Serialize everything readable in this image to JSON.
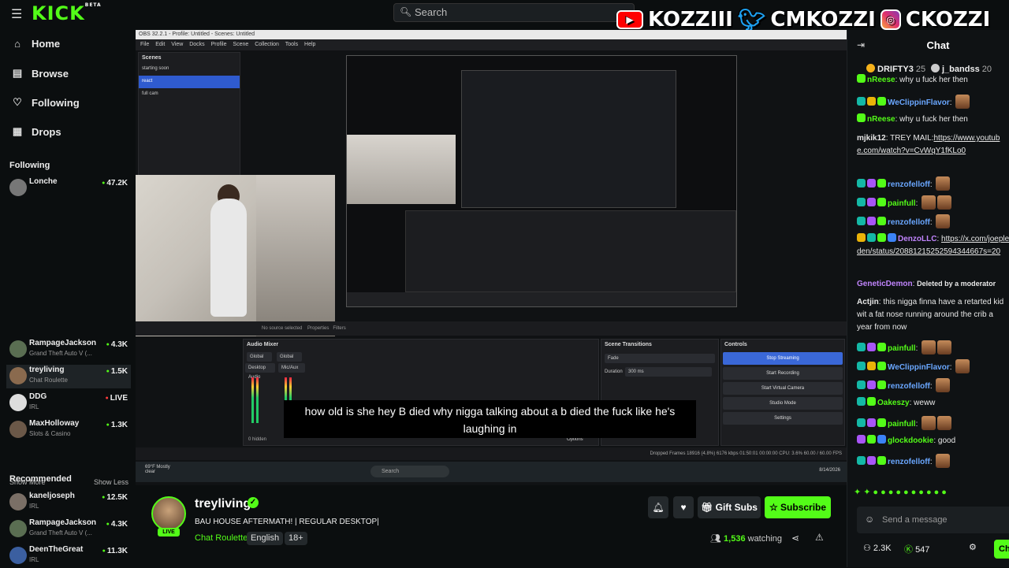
{
  "topbar": {
    "logo": "KICK",
    "logo_beta": "BETA",
    "search_placeholder": "Search"
  },
  "overlay": {
    "youtube": "KOZZIII",
    "twitter": "CMKOZZI",
    "instagram": "CKOZZI"
  },
  "nav": [
    {
      "label": "Home",
      "icon": "home-icon"
    },
    {
      "label": "Browse",
      "icon": "browse-icon"
    },
    {
      "label": "Following",
      "icon": "heart-icon"
    },
    {
      "label": "Drops",
      "icon": "drops-icon"
    }
  ],
  "following": {
    "title": "Following",
    "channels": [
      {
        "name": "Lonche",
        "category": "",
        "viewers": "47.2K"
      },
      {
        "name": "RampageJackson",
        "category": "Grand Theft Auto V (...",
        "viewers": "4.3K"
      },
      {
        "name": "treyliving",
        "category": "Chat Roulette",
        "viewers": "1.5K"
      },
      {
        "name": "DDG",
        "category": "IRL",
        "viewers": "LIVE"
      },
      {
        "name": "MaxHolloway",
        "category": "Slots & Casino",
        "viewers": "1.3K"
      }
    ],
    "show_more": "Show More",
    "show_less": "Show Less"
  },
  "recommended": {
    "title": "Recommended",
    "channels": [
      {
        "name": "kaneljoseph",
        "category": "IRL",
        "viewers": "12.5K"
      },
      {
        "name": "RampageJackson",
        "category": "Grand Theft Auto V (...",
        "viewers": "4.3K"
      },
      {
        "name": "DeenTheGreat",
        "category": "IRL",
        "viewers": "11.3K"
      }
    ]
  },
  "stream": {
    "obs_title": "OBS 32.2.1 - Profile: Untitled - Scenes: Untitled",
    "obs_menu": "File Edit View Docks Profile Scene Collection Tools Help",
    "scenes_title": "Scenes",
    "scenes": [
      "starting soon",
      "react",
      "full cam"
    ],
    "no_source": "No source selected",
    "properties": "Properties",
    "filters": "Filters",
    "audio_mixer": "Audio Mixer",
    "mixer_tabs": [
      "Global",
      "Global"
    ],
    "mixer_channels": [
      "Desktop Audio",
      "Mic/Aux"
    ],
    "hidden": "0 hidden",
    "scene_transitions": "Scene Transitions",
    "transition": "Fade",
    "duration_label": "Duration",
    "duration": "300 ms",
    "controls_title": "Controls",
    "controls": [
      "Stop Streaming",
      "Start Recording",
      "Start Virtual Camera",
      "Studio Mode",
      "Settings"
    ],
    "options": "Options",
    "status": "Dropped Frames 18916 (4.8%)   6176 kbps   01:50:01   00:00:00   CPU: 3.6%   60.00 / 60.00 FPS",
    "weather": "69°F Mostly clear",
    "task_search": "Search",
    "clock": "8/14/2026",
    "subtitle": "how old is she hey B died why nigga talking about a b died the fuck like he's laughing in"
  },
  "channel": {
    "name": "treyliving",
    "live": "LIVE",
    "title": "BAU HOUSE AFTERMATH! | REGULAR DESKTOP|",
    "category": "Chat Roulette",
    "tags": [
      "English",
      "18+"
    ],
    "gift_subs": "Gift Subs",
    "subscribe": "Subscribe",
    "watching_count": "1,536",
    "watching_label": "watching"
  },
  "chat": {
    "title": "Chat",
    "top_gifters": [
      {
        "name": "DRIFTY3",
        "count": "25"
      },
      {
        "name": "j_bandss",
        "count": "20"
      }
    ],
    "messages": [
      {
        "user": "nReese",
        "text": "why u fuck her then",
        "color": "#53fc18"
      },
      {
        "user": "WeClippinFlavor",
        "text": "",
        "color": "#3b82f6"
      },
      {
        "user": "nReese",
        "text": "why u fuck her then",
        "color": "#53fc18"
      },
      {
        "user": "mjkik12",
        "text": "TREY MAIL:",
        "link": "https://www.youtube.com/watch?v=CvWqY1fKLo0",
        "color": "#e8e8e8"
      },
      {
        "user": "renzofelloff",
        "text": "",
        "color": "#3b82f6"
      },
      {
        "user": "painfull",
        "text": "",
        "color": "#53fc18"
      },
      {
        "user": "renzofelloff",
        "text": "",
        "color": "#3b82f6"
      },
      {
        "user": "DenzoLLC",
        "text": "",
        "link": "https://x.com/joepleden/status/20881215252594344667s=20",
        "color": "#a855f7"
      },
      {
        "user": "GeneticDemon",
        "text": "Deleted by a moderator",
        "color": "#a855f7"
      },
      {
        "user": "Actjin",
        "text": "this nigga finna have a retarted kid wit a fat nose running around the crib a year from now",
        "color": "#e8e8e8"
      },
      {
        "user": "painfull",
        "text": "",
        "color": "#53fc18"
      },
      {
        "user": "WeClippinFlavor",
        "text": "",
        "color": "#3b82f6"
      },
      {
        "user": "renzofelloff",
        "text": "",
        "color": "#3b82f6"
      },
      {
        "user": "Oakeszy",
        "text": "weww",
        "color": "#53fc18"
      },
      {
        "user": "painfull",
        "text": "",
        "color": "#53fc18"
      },
      {
        "user": "glockdookie",
        "text": "good",
        "color": "#53fc18"
      },
      {
        "user": "renzofelloff",
        "text": "",
        "color": "#3b82f6"
      }
    ],
    "input_placeholder": "Send a message",
    "followers": "2.3K",
    "points": "547",
    "chat_button": "Chat"
  },
  "colors": {
    "brand": "#53fc18",
    "bg": "#0b0e0f",
    "obs_blue": "#3a68d8"
  }
}
